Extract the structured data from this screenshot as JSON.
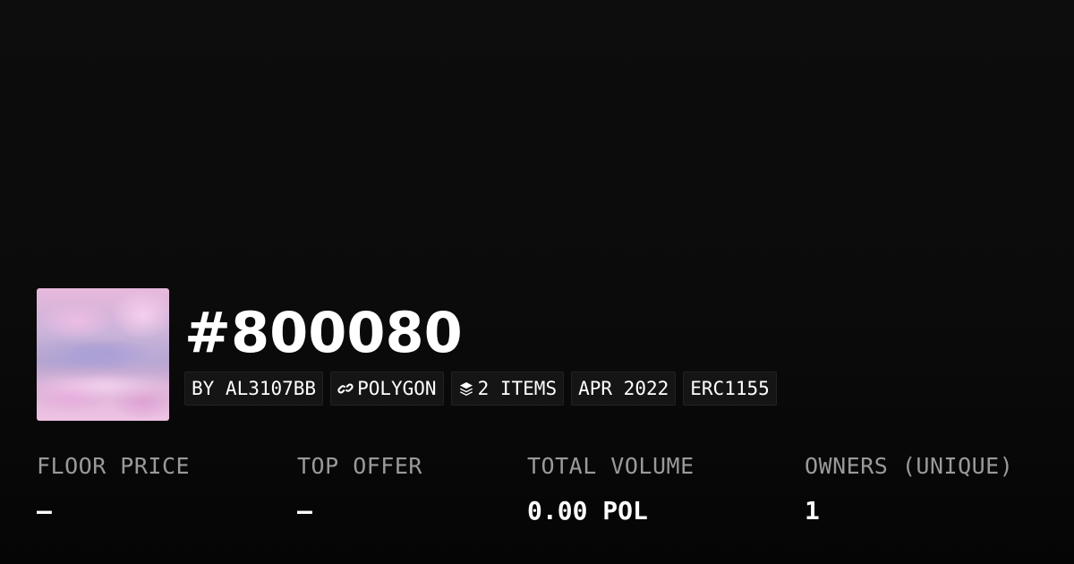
{
  "collection": {
    "name": "#800080",
    "thumbnail_icon": "collection-artwork"
  },
  "tags": {
    "creator": "BY AL3107BB",
    "chain": "POLYGON",
    "chain_icon": "polygon-link-icon",
    "items": "2 ITEMS",
    "items_icon": "layers-icon",
    "date": "APR 2022",
    "standard": "ERC1155"
  },
  "stats": {
    "floor_price": {
      "label": "FLOOR PRICE",
      "value": "–"
    },
    "top_offer": {
      "label": "TOP OFFER",
      "value": "–"
    },
    "total_volume": {
      "label": "TOTAL VOLUME",
      "value": "0.00 POL"
    },
    "owners": {
      "label": "OWNERS (UNIQUE)",
      "value": "1"
    }
  },
  "colors": {
    "background": "#0b0b0b",
    "tag_background": "#151515",
    "label_gray": "#9a9a9a",
    "text_white": "#ffffff"
  }
}
